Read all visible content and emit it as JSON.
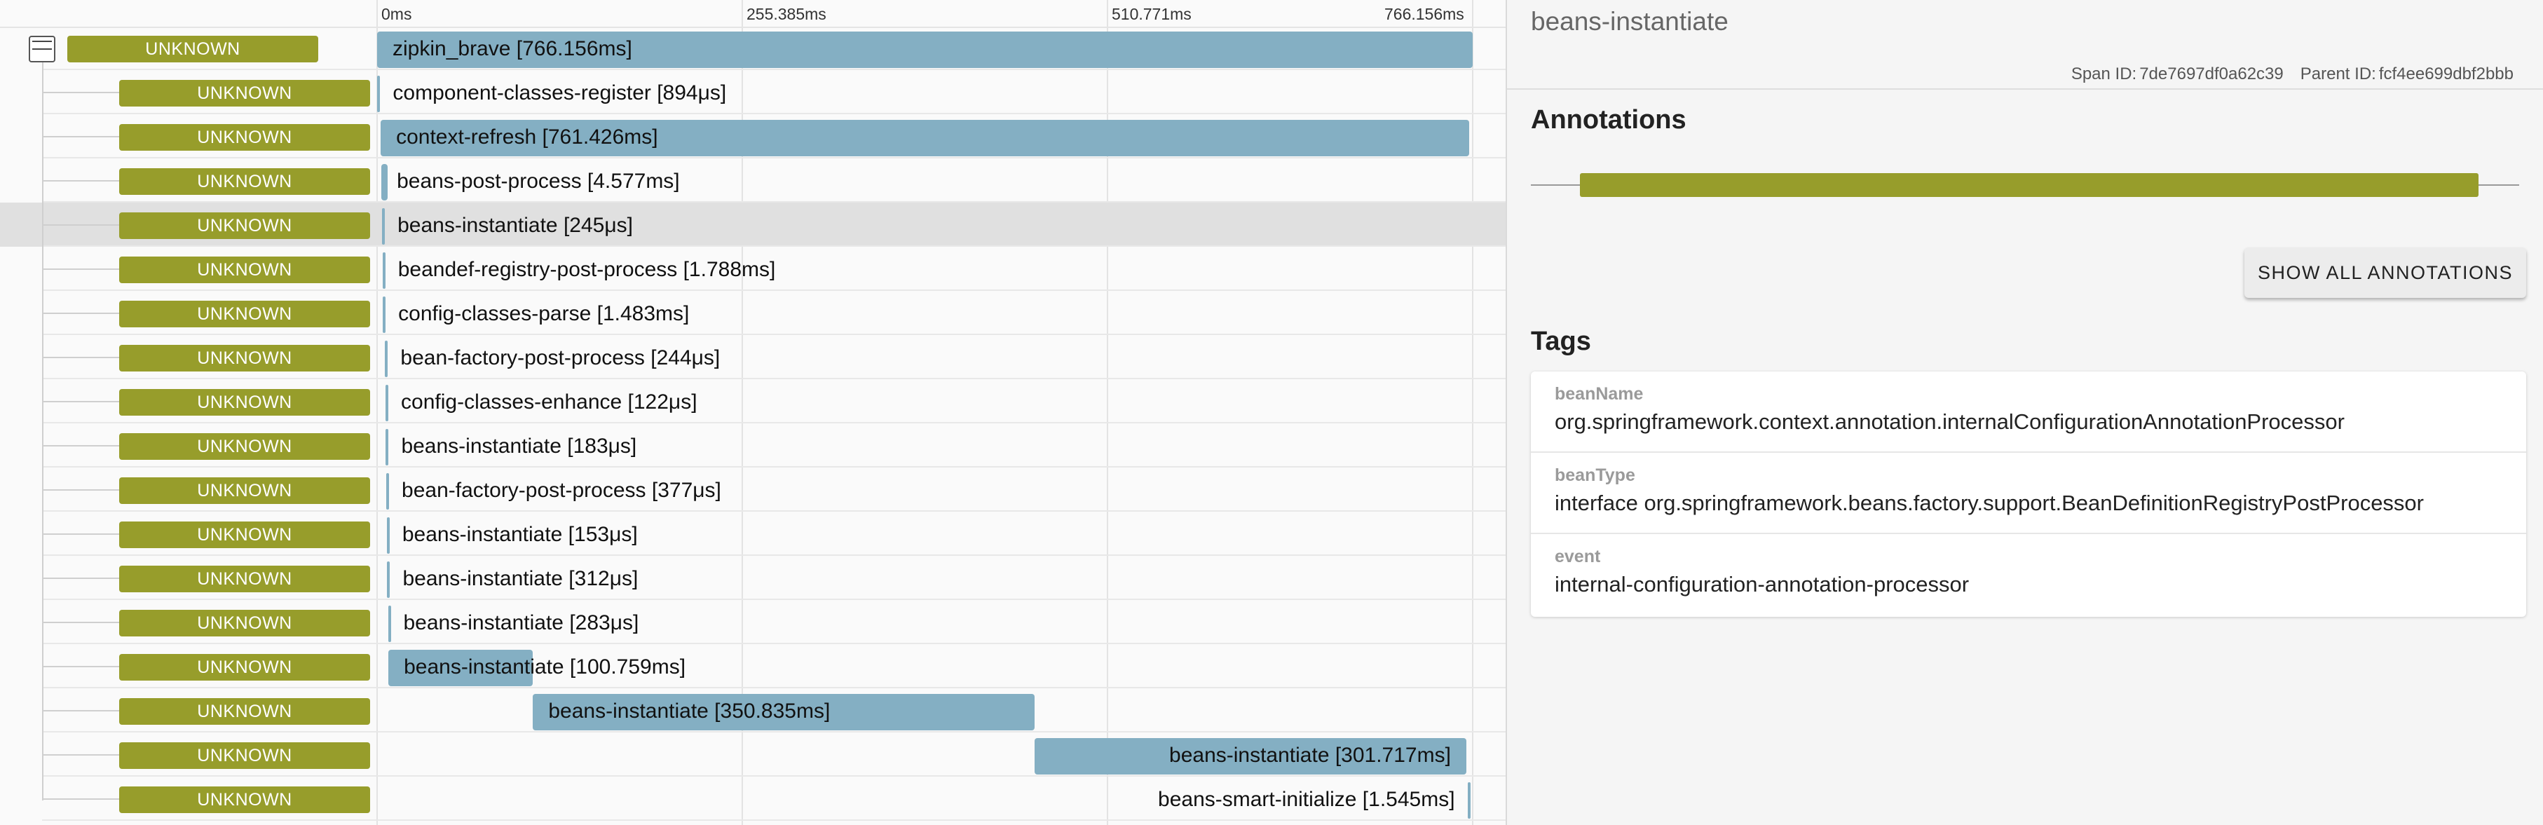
{
  "axis": {
    "ticks": [
      {
        "label": "0ms"
      },
      {
        "label": "255.385ms"
      },
      {
        "label": "510.771ms"
      },
      {
        "label": "766.156ms"
      }
    ]
  },
  "spans": [
    {
      "service": "UNKNOWN",
      "label": "zipkin_brave [766.156ms]",
      "start_ms": 0,
      "duration_ms": 766.156,
      "depth": 0,
      "selected": false
    },
    {
      "service": "UNKNOWN",
      "label": "component-classes-register [894μs]",
      "start_ms": 0.2,
      "duration_ms": 0.894,
      "depth": 1,
      "selected": false
    },
    {
      "service": "UNKNOWN",
      "label": "context-refresh [761.426ms]",
      "start_ms": 2.5,
      "duration_ms": 761.426,
      "depth": 1,
      "selected": false
    },
    {
      "service": "UNKNOWN",
      "label": "beans-post-process [4.577ms]",
      "start_ms": 3.0,
      "duration_ms": 4.577,
      "depth": 1,
      "selected": false
    },
    {
      "service": "UNKNOWN",
      "label": "beans-instantiate [245μs]",
      "start_ms": 3.5,
      "duration_ms": 0.245,
      "depth": 1,
      "selected": true
    },
    {
      "service": "UNKNOWN",
      "label": "beandef-registry-post-process [1.788ms]",
      "start_ms": 3.8,
      "duration_ms": 1.788,
      "depth": 1,
      "selected": false
    },
    {
      "service": "UNKNOWN",
      "label": "config-classes-parse [1.483ms]",
      "start_ms": 4.0,
      "duration_ms": 1.483,
      "depth": 1,
      "selected": false
    },
    {
      "service": "UNKNOWN",
      "label": "bean-factory-post-process [244μs]",
      "start_ms": 5.6,
      "duration_ms": 0.244,
      "depth": 1,
      "selected": false
    },
    {
      "service": "UNKNOWN",
      "label": "config-classes-enhance [122μs]",
      "start_ms": 5.9,
      "duration_ms": 0.122,
      "depth": 1,
      "selected": false
    },
    {
      "service": "UNKNOWN",
      "label": "beans-instantiate [183μs]",
      "start_ms": 6.1,
      "duration_ms": 0.183,
      "depth": 1,
      "selected": false
    },
    {
      "service": "UNKNOWN",
      "label": "bean-factory-post-process [377μs]",
      "start_ms": 6.4,
      "duration_ms": 0.377,
      "depth": 1,
      "selected": false
    },
    {
      "service": "UNKNOWN",
      "label": "beans-instantiate [153μs]",
      "start_ms": 6.8,
      "duration_ms": 0.153,
      "depth": 1,
      "selected": false
    },
    {
      "service": "UNKNOWN",
      "label": "beans-instantiate [312μs]",
      "start_ms": 7.1,
      "duration_ms": 0.312,
      "depth": 1,
      "selected": false
    },
    {
      "service": "UNKNOWN",
      "label": "beans-instantiate [283μs]",
      "start_ms": 7.6,
      "duration_ms": 0.283,
      "depth": 1,
      "selected": false
    },
    {
      "service": "UNKNOWN",
      "label": "beans-instantiate [100.759ms]",
      "start_ms": 7.9,
      "duration_ms": 100.759,
      "depth": 1,
      "selected": false
    },
    {
      "service": "UNKNOWN",
      "label": "beans-instantiate [350.835ms]",
      "start_ms": 109.0,
      "duration_ms": 350.835,
      "depth": 1,
      "selected": false
    },
    {
      "service": "UNKNOWN",
      "label": "beans-instantiate [301.717ms]",
      "start_ms": 460.0,
      "duration_ms": 301.717,
      "depth": 1,
      "selected": false
    },
    {
      "service": "UNKNOWN",
      "label": "beans-smart-initialize [1.545ms]",
      "start_ms": 762.5,
      "duration_ms": 1.545,
      "depth": 1,
      "selected": false
    }
  ],
  "detail": {
    "title": "beans-instantiate",
    "span_id_label": "Span ID:",
    "span_id": "7de7697df0a62c39",
    "parent_id_label": "Parent ID:",
    "parent_id": "fcf4ee699dbf2bbb",
    "annotations_title": "Annotations",
    "show_all_label": "SHOW ALL ANNOTATIONS",
    "tags_title": "Tags",
    "tags": [
      {
        "key": "beanName",
        "value": "org.springframework.context.annotation.internalConfigurationAnnotationProcessor"
      },
      {
        "key": "beanType",
        "value": "interface org.springframework.beans.factory.support.BeanDefinitionRegistryPostProcessor"
      },
      {
        "key": "event",
        "value": "internal-configuration-annotation-processor"
      }
    ]
  },
  "colors": {
    "service_badge": "#979d2b",
    "span_bar": "#84afc3",
    "selected_row": "#e0e0e0"
  }
}
